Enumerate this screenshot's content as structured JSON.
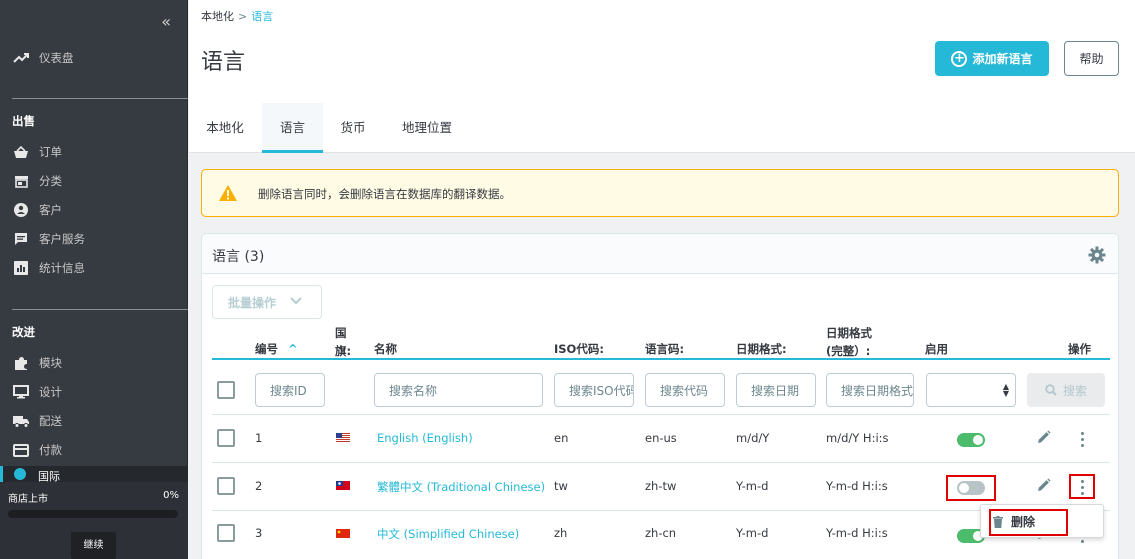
{
  "sidebar": {
    "collapse_icon": "«",
    "dashboard": "仪表盘",
    "sell_title": "出售",
    "sell_items": [
      "订单",
      "分类",
      "客户",
      "客户服务",
      "统计信息"
    ],
    "improve_title": "改进",
    "improve_items": [
      "模块",
      "设计",
      "配送",
      "付款"
    ],
    "active_item": "国际",
    "store_launch": {
      "label": "商店上市",
      "percent": "0%",
      "progress": 0,
      "continue": "继续"
    }
  },
  "breadcrumb": {
    "parent": "本地化",
    "separator": ">",
    "current": "语言"
  },
  "page_title": "语言",
  "toolbar": {
    "add_label": "添加新语言",
    "help_label": "帮助"
  },
  "tabs": [
    {
      "label": "本地化",
      "active": false
    },
    {
      "label": "语言",
      "active": true
    },
    {
      "label": "货币",
      "active": false
    },
    {
      "label": "地理位置",
      "active": false
    }
  ],
  "alert": {
    "message": "删除语言同时，会删除语言在数据库的翻译数据。"
  },
  "card": {
    "title": "语言 (3)",
    "bulk_label": "批量操作"
  },
  "table": {
    "headers": {
      "id": "编号",
      "sort_icon": "^",
      "flag_line1": "国",
      "flag_line2": "旗:",
      "name": "名称",
      "iso": "ISO代码:",
      "lang_code": "语言码:",
      "date_format": "日期格式:",
      "full_date_line1": "日期格式",
      "full_date_line2": "(完整）:",
      "enabled": "启用",
      "actions": "操作"
    },
    "filters": {
      "id": "搜索ID",
      "name": "搜索名称",
      "iso": "搜索ISO代码",
      "lang_code": "搜索代码",
      "date_format": "搜索日期",
      "full_date": "搜索日期格式",
      "search_button": "搜索"
    },
    "rows": [
      {
        "id": "1",
        "flag": "us",
        "name": "English (English)",
        "iso": "en",
        "lang_code": "en-us",
        "date_format": "m/d/Y",
        "full_date": "m/d/Y H:i:s",
        "enabled": true
      },
      {
        "id": "2",
        "flag": "tw",
        "name": "繁體中文 (Traditional Chinese)",
        "iso": "tw",
        "lang_code": "zh-tw",
        "date_format": "Y-m-d",
        "full_date": "Y-m-d H:i:s",
        "enabled": false
      },
      {
        "id": "3",
        "flag": "cn",
        "name": "中文 (Simplified Chinese)",
        "iso": "zh",
        "lang_code": "zh-cn",
        "date_format": "Y-m-d",
        "full_date": "Y-m-d H:i:s",
        "enabled": true
      }
    ]
  },
  "dropdown": {
    "delete_label": "删除"
  },
  "colors": {
    "accent": "#25b9d7",
    "sidebar": "#363a41",
    "toggle_on": "#4cbb6c",
    "highlight": "#e00000"
  }
}
